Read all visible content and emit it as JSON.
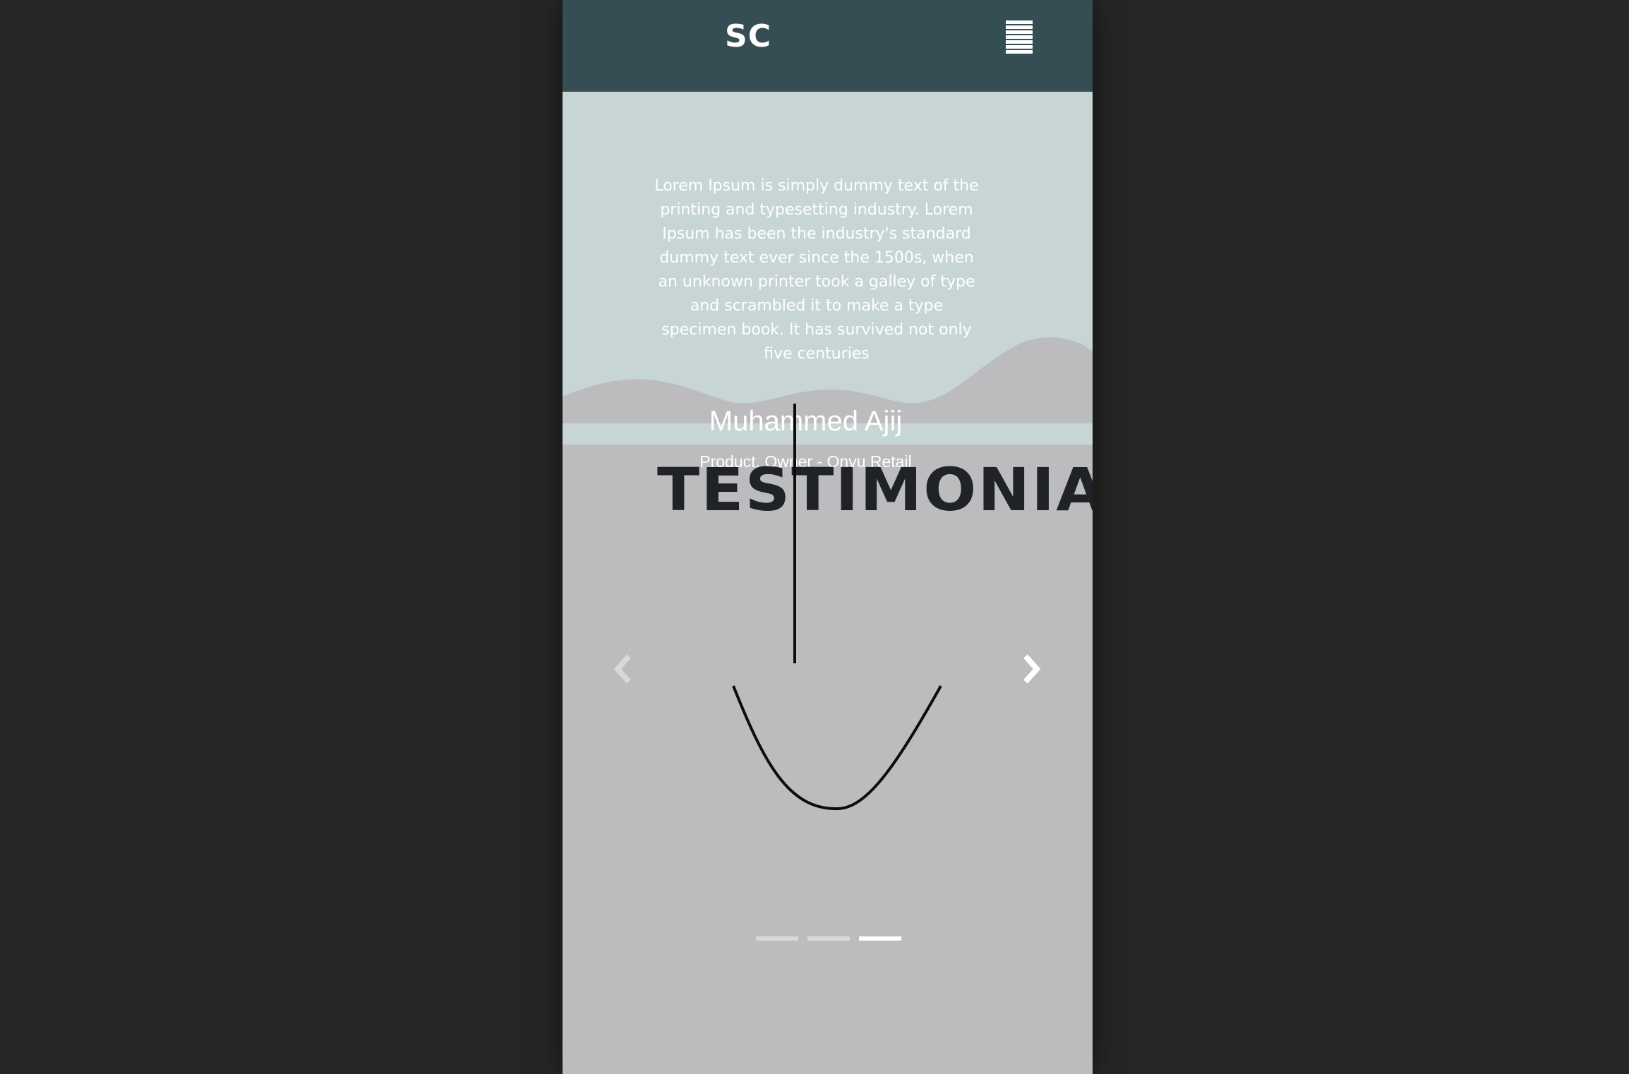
{
  "navbar": {
    "logo": "SC",
    "background": "#354e54",
    "menu_icon": "hamburger-menu-icon"
  },
  "hero": {
    "background": "#c8d5d5",
    "quote": "Lorem Ipsum is simply dummy text of the printing and typesetting industry. Lorem Ipsum has been the industry's standard dummy text ever since the 1500s, when an unknown printer took a galley of type and scrambled it to make a type specimen book. It has survived not only five centuries"
  },
  "testimonial": {
    "author": "Muhammed Ajij",
    "role": "Product. Owner - Onvu Retail",
    "heading": "TESTIMONIAL",
    "background": "#bcbcbe"
  },
  "carousel": {
    "prev_icon": "chevron-left-icon",
    "next_icon": "chevron-right-icon",
    "slide_count": 3,
    "active_index": 2
  },
  "page": {
    "background": "#262626"
  }
}
